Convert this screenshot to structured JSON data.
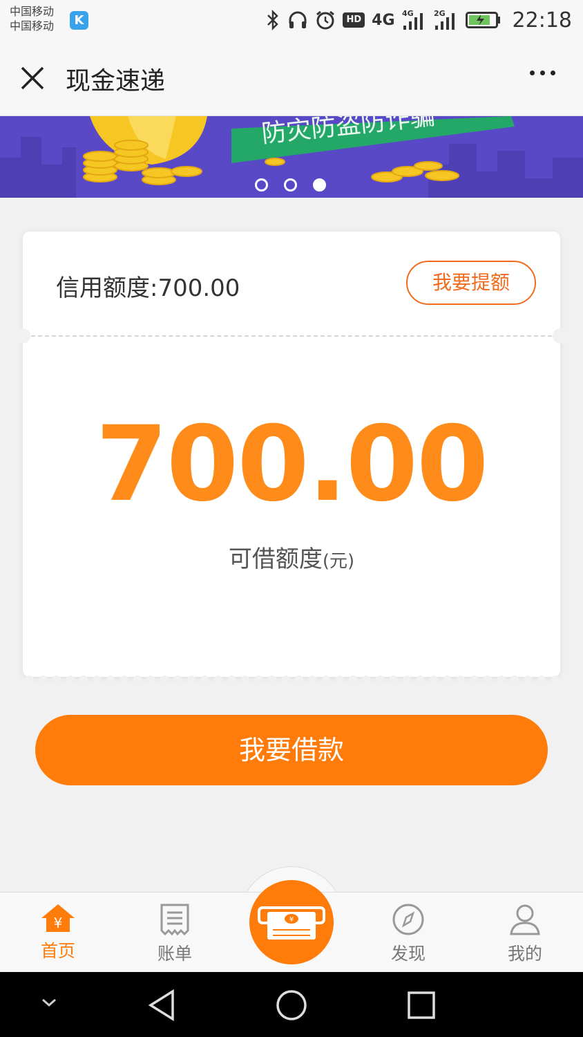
{
  "status_bar": {
    "carrier_1": "中国移动",
    "carrier_2": "中国移动",
    "badge": "K",
    "hd": "HD",
    "net_1": "4G",
    "net_2": "4G",
    "net_3": "2G",
    "time": "22:18"
  },
  "title_bar": {
    "title": "现金速递"
  },
  "banner": {
    "text": "防灾防盗防诈骗",
    "slide_count": 3,
    "active_slide": 3
  },
  "card": {
    "credit_label": "信用额度:700.00",
    "raise_button": "我要提额",
    "amount": "700.00",
    "amount_label": "可借额度",
    "amount_unit": "(元)"
  },
  "borrow_button": "我要借款",
  "tabs": [
    {
      "label": "首页",
      "icon": "home-yen-icon",
      "active": true
    },
    {
      "label": "账单",
      "icon": "bill-icon",
      "active": false
    },
    {
      "label": "发现",
      "icon": "compass-icon",
      "active": false
    },
    {
      "label": "我的",
      "icon": "user-icon",
      "active": false
    }
  ],
  "center_tab_icon": "cash-atm-icon",
  "colors": {
    "accent": "#ff7b0a",
    "amount": "#ff8c1a",
    "banner_bg": "#5a49c7"
  }
}
